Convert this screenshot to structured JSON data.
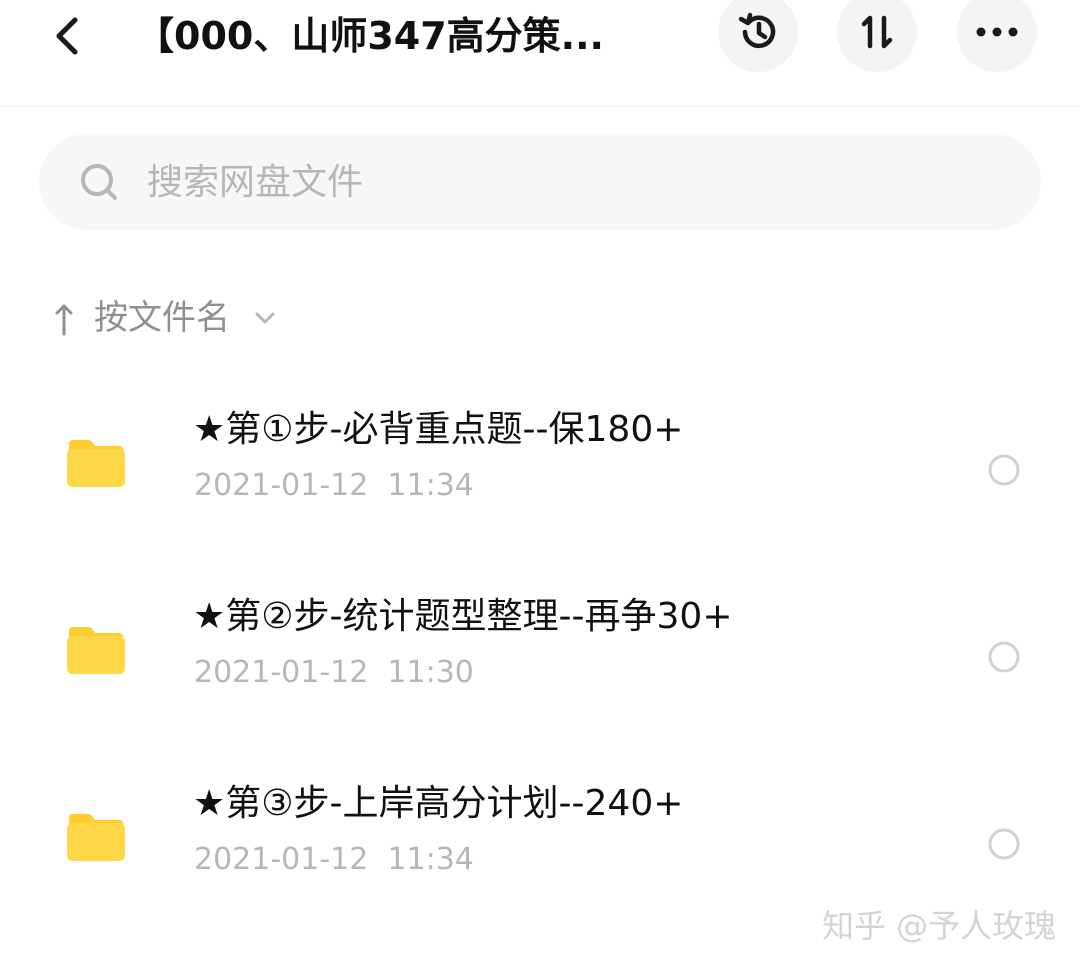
{
  "header": {
    "title": "【000、山师347高分策..."
  },
  "search": {
    "placeholder": "搜索网盘文件"
  },
  "sort": {
    "label": "按文件名"
  },
  "files": [
    {
      "name": "★第①步-必背重点题--保180+",
      "date": "2021-01-12  11:34"
    },
    {
      "name": "★第②步-统计题型整理--再争30+",
      "date": "2021-01-12  11:30"
    },
    {
      "name": "★第③步-上岸高分计划--240+",
      "date": "2021-01-12  11:34"
    }
  ],
  "watermark": "知乎 @予人玫瑰",
  "colors": {
    "folder": "#FFD84A",
    "folder_tab": "#FFCD2E",
    "secondary_text": "#b5b7be"
  }
}
